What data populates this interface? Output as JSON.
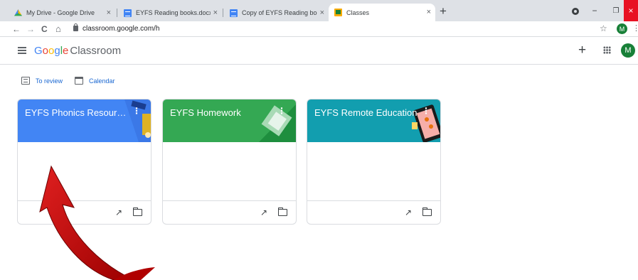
{
  "browser": {
    "tabs": [
      {
        "title": "My Drive - Google Drive",
        "favicon": "drive-icon",
        "active": false
      },
      {
        "title": "EYFS Reading books.docx - Goog",
        "favicon": "docs-icon",
        "active": false
      },
      {
        "title": "Copy of EYFS Reading books.doc",
        "favicon": "docs-icon",
        "active": false
      },
      {
        "title": "Classes",
        "favicon": "classroom-icon",
        "active": true
      }
    ],
    "tab_close_glyph": "×",
    "new_tab_glyph": "+",
    "url": "classroom.google.com/h",
    "profile_initial": "M",
    "window": {
      "minimize": "−",
      "restore": "❐",
      "close": "×"
    },
    "nav": {
      "back": "←",
      "forward": "→",
      "reload": "C",
      "home": "⌂",
      "star": "☆",
      "menu": "⋮"
    }
  },
  "header": {
    "logo_letters": [
      "G",
      "o",
      "o",
      "g",
      "l",
      "e"
    ],
    "product": "Classroom",
    "plus": "+",
    "avatar_initial": "M"
  },
  "quicklinks": [
    {
      "label": "To review",
      "icon": "review-icon"
    },
    {
      "label": "Calendar",
      "icon": "calendar-icon"
    }
  ],
  "cards": [
    {
      "title": "EYFS Phonics Resources",
      "color": "#4285f4",
      "menu": "⋮",
      "trend": "↗",
      "theme": "phonics"
    },
    {
      "title": "EYFS Homework",
      "color": "#34a853",
      "menu": "⋮",
      "trend": "↗",
      "theme": "homework"
    },
    {
      "title": "EYFS Remote Education",
      "color": "#129eaf",
      "menu": "⋮",
      "trend": "↗",
      "theme": "remote"
    }
  ],
  "colors": {
    "annotation_arrow": "#c00000",
    "tabstrip": "#dee1e6",
    "link": "#1967d2",
    "avatar": "#188038"
  }
}
